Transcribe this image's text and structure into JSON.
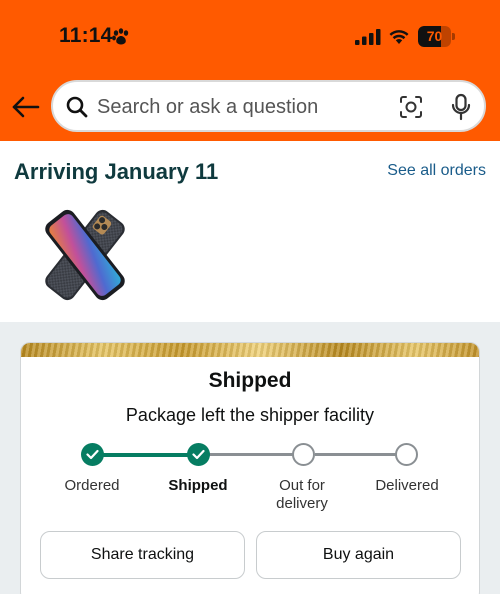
{
  "status_bar": {
    "time": "11:14",
    "battery": "70",
    "battery_level": 0.7
  },
  "search": {
    "placeholder": "Search or ask a question"
  },
  "icons": [
    "back-arrow-icon",
    "search-icon",
    "camera-lens-icon",
    "microphone-icon",
    "paw-icon",
    "signal-icon",
    "wifi-icon",
    "battery-icon",
    "check-icon"
  ],
  "order": {
    "arriving": "Arriving January 11",
    "see_all": "See all orders"
  },
  "card": {
    "status": "Shipped",
    "message": "Package left the shipper facility",
    "steps": [
      {
        "label": "Ordered",
        "done": true
      },
      {
        "label": "Shipped",
        "done": true,
        "current": true
      },
      {
        "label": "Out for delivery",
        "done": false
      },
      {
        "label": "Delivered",
        "done": false
      }
    ],
    "share_label": "Share tracking",
    "buy_label": "Buy again"
  },
  "colors": {
    "header": "#ff5a00",
    "progress": "#067d62",
    "link": "#1a5c8a",
    "title": "#0f3a3e"
  }
}
